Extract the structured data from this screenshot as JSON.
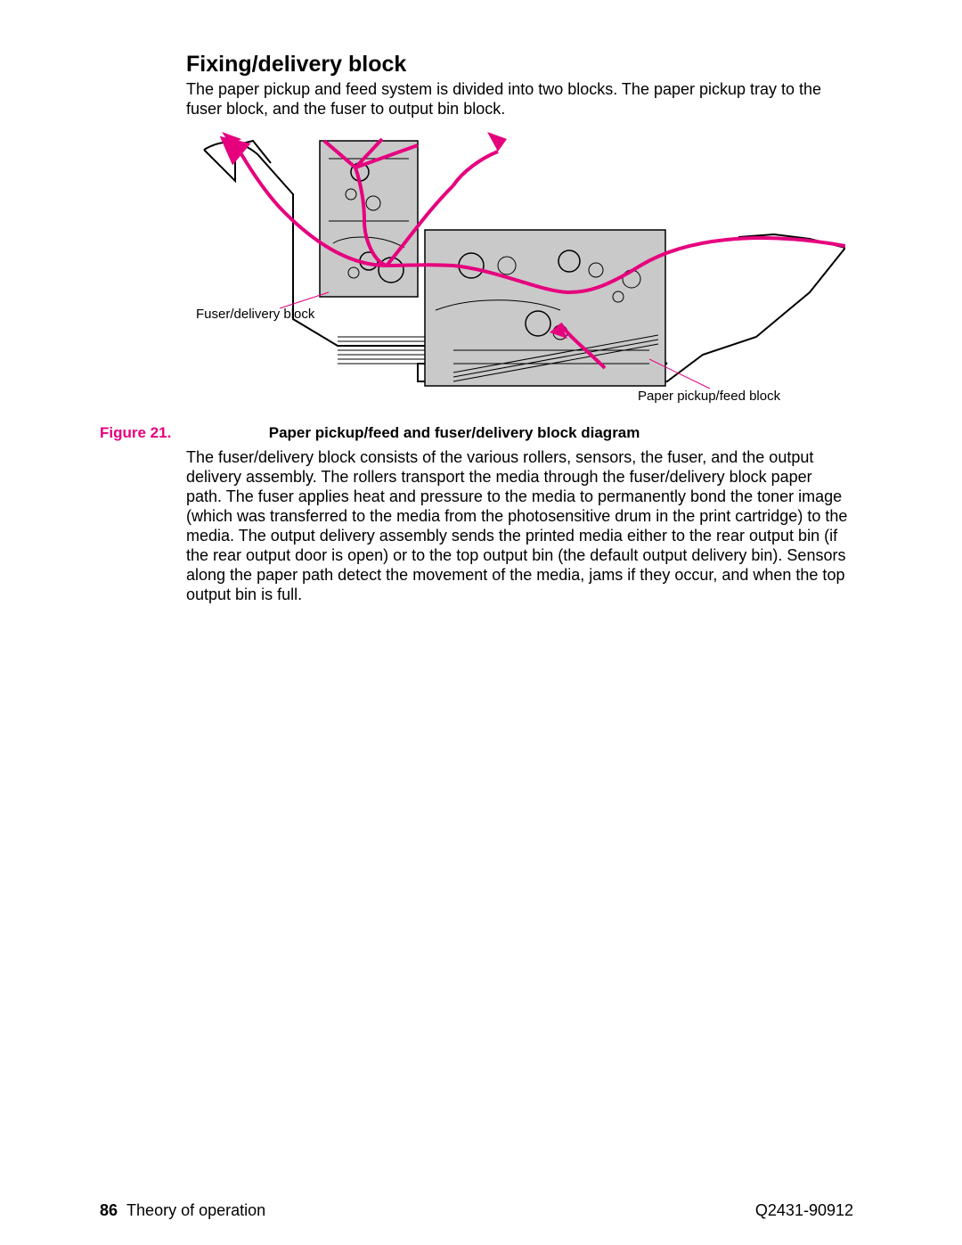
{
  "heading": "Fixing/delivery block",
  "intro": "The paper pickup and feed system is divided into two blocks. The paper pickup tray to the fuser block, and the fuser to output bin block.",
  "diagram": {
    "fuser_label": "Fuser/delivery block",
    "paper_label": "Paper pickup/feed block"
  },
  "figure": {
    "number": "Figure 21.",
    "caption": "Paper pickup/feed and fuser/delivery block diagram"
  },
  "body": "The fuser/delivery block consists of the various rollers, sensors, the fuser, and the output delivery assembly. The rollers transport the media through the fuser/delivery block paper path. The fuser applies heat and pressure to the media to permanently bond the toner image (which was transferred to the media from the photosensitive drum in the print cartridge) to the media. The output delivery assembly sends the printed media either to the rear output bin (if the rear output door is open) or to the top output bin (the default output delivery bin). Sensors along the paper path detect the movement of the media, jams if they occur, and when the top output bin is full.",
  "footer": {
    "page_number": "86",
    "section": "Theory of operation",
    "doc_id": "Q2431-90912"
  },
  "colors": {
    "magenta": "#E6007E",
    "grey_fill": "#C9C9C9"
  }
}
